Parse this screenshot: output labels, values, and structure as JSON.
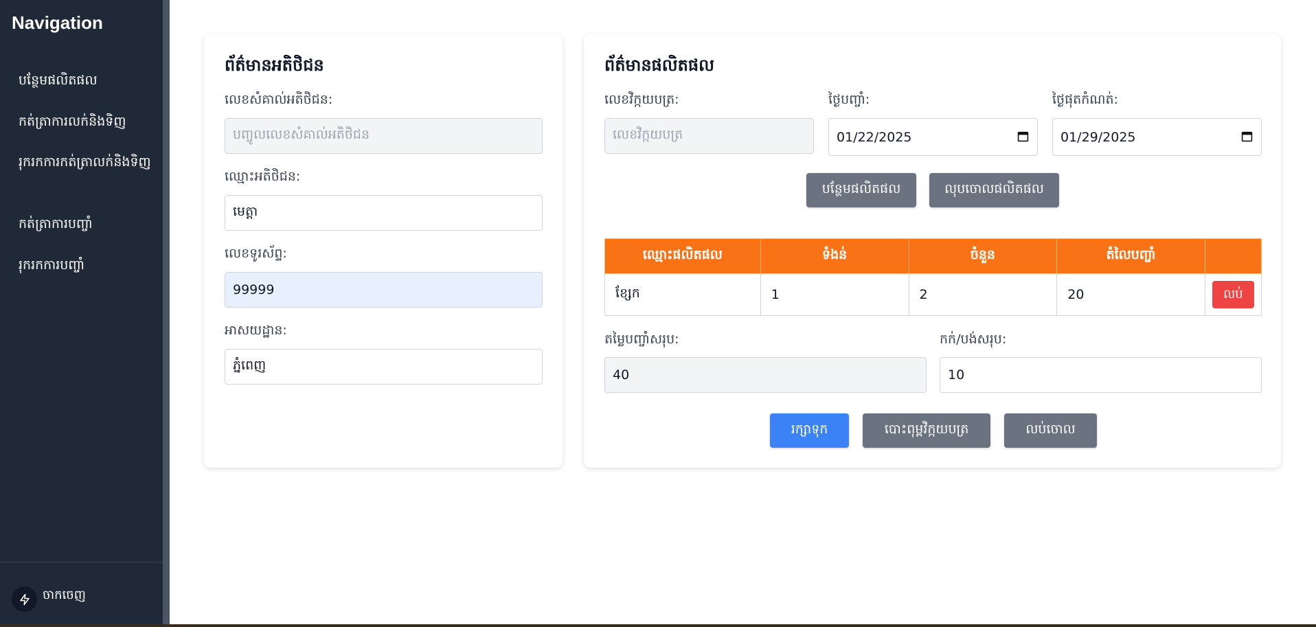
{
  "sidebar": {
    "title": "Navigation",
    "items": [
      {
        "label": "បន្ថែមផលិតផល"
      },
      {
        "label": "កត់ត្រាការលក់និងទិញ"
      },
      {
        "label": "រុករកការកត់ត្រាលក់និងទិញ"
      },
      {
        "label": "កត់ត្រាការបញ្ចាំ"
      },
      {
        "label": "រុករកការបញ្ចាំ"
      }
    ],
    "logout_label": "ចាកចេញ",
    "logout_icon": "bolt-icon"
  },
  "customer": {
    "title": "ព័ត៌មានអតិថិជន",
    "id_label": "លេខសំគាល់អតិថិជន:",
    "id_placeholder": "បញ្ចូលលេខសំគាល់អតិថិជន",
    "name_label": "ឈ្មោះអតិថិជន:",
    "name_value": "មេត្តា",
    "phone_label": "លេខទូរស័ព្ទ:",
    "phone_value": "99999",
    "address_label": "អាសយដ្ឋាន:",
    "address_value": "ភ្នំពេញ"
  },
  "product": {
    "title": "ព័ត៌មានផលិតផល",
    "invoice_label": "លេខវិក្កយបត្រ:",
    "invoice_placeholder": "លេខវិក្កយបត្រ",
    "pawn_date_label": "ថ្ងៃបញ្ចាំ:",
    "pawn_date_value": "01/22/2025",
    "due_date_label": "ថ្ងៃផុតកំណត់:",
    "due_date_value": "01/29/2025",
    "add_button": "បន្ថែមផលិតផល",
    "clear_button": "លុបចោលផលិតផល",
    "table": {
      "headers": [
        "ឈ្មោះផលិតផល",
        "ទំងន់",
        "ចំនួន",
        "តំលៃបញ្ចាំ",
        ""
      ],
      "rows": [
        {
          "name": "ខ្សែក",
          "weight": "1",
          "quantity": "2",
          "price": "20",
          "delete_label": "លប់"
        }
      ]
    },
    "total_label": "តម្លៃបញ្ចាំសរុប:",
    "total_value": "40",
    "deduct_label": "កក់/បង់សរុប:",
    "deduct_value": "10",
    "save_button": "រក្សាទុក",
    "print_button": "បោះពុម្ពវិក្កយបត្រ",
    "cancel_button": "លប់ចោល"
  },
  "colors": {
    "sidebar_bg": "#1f2937",
    "table_header": "#f97316",
    "primary": "#3b82f6",
    "danger": "#ef4444",
    "secondary": "#6b7280"
  }
}
